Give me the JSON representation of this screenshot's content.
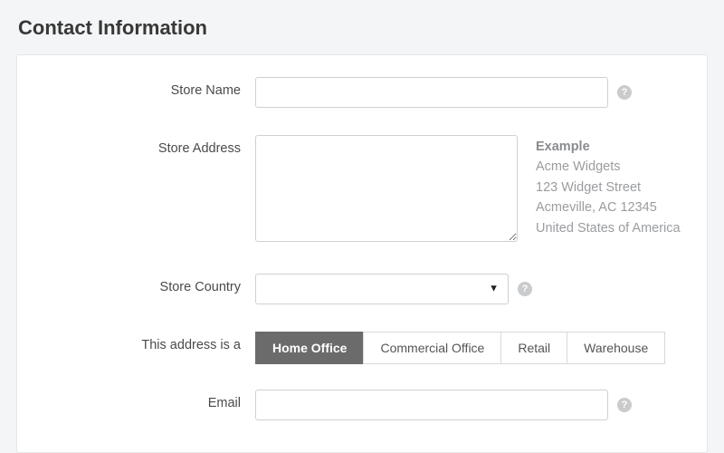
{
  "section_title": "Contact Information",
  "fields": {
    "store_name": {
      "label": "Store Name",
      "value": ""
    },
    "store_address": {
      "label": "Store Address",
      "value": ""
    },
    "store_country": {
      "label": "Store Country",
      "value": ""
    },
    "address_type": {
      "label": "This address is a"
    },
    "email": {
      "label": "Email",
      "value": ""
    }
  },
  "example": {
    "title": "Example",
    "line1": "Acme Widgets",
    "line2": "123 Widget Street",
    "line3": "Acmeville, AC 12345",
    "line4": "United States of America"
  },
  "address_type_options": {
    "opt0": "Home Office",
    "opt1": "Commercial Office",
    "opt2": "Retail",
    "opt3": "Warehouse",
    "selected": "Home Office"
  },
  "icons": {
    "help_glyph": "?",
    "caret_glyph": "▼"
  }
}
